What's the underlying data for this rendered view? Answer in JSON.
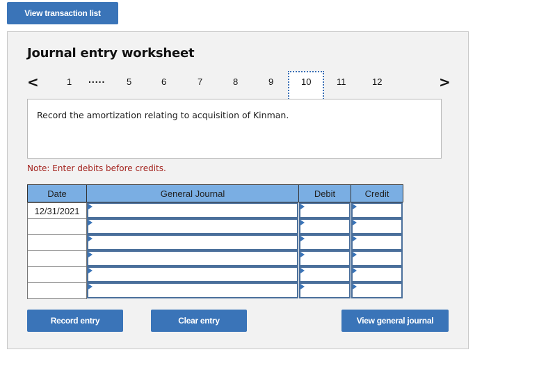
{
  "top_button": {
    "label": "View transaction list"
  },
  "worksheet": {
    "title": "Journal entry worksheet",
    "pager": {
      "prev_icon": "<",
      "next_icon": ">",
      "items": [
        "1",
        ".....",
        "5",
        "6",
        "7",
        "8",
        "9",
        "10",
        "11",
        "12"
      ],
      "active": "10"
    },
    "prompt": "Record the amortization relating to acquisition of Kinman.",
    "note": "Note: Enter debits before credits.",
    "table": {
      "headers": [
        "Date",
        "General Journal",
        "Debit",
        "Credit"
      ],
      "rows": [
        {
          "date": "12/31/2021",
          "account": "",
          "debit": "",
          "credit": ""
        },
        {
          "date": "",
          "account": "",
          "debit": "",
          "credit": ""
        },
        {
          "date": "",
          "account": "",
          "debit": "",
          "credit": ""
        },
        {
          "date": "",
          "account": "",
          "debit": "",
          "credit": ""
        },
        {
          "date": "",
          "account": "",
          "debit": "",
          "credit": ""
        },
        {
          "date": "",
          "account": "",
          "debit": "",
          "credit": ""
        }
      ]
    },
    "buttons": {
      "record": "Record entry",
      "clear": "Clear entry",
      "view_journal": "View general journal"
    }
  },
  "colors": {
    "button": "#3a74b8",
    "header": "#7aaee3",
    "note": "#a3221d"
  }
}
